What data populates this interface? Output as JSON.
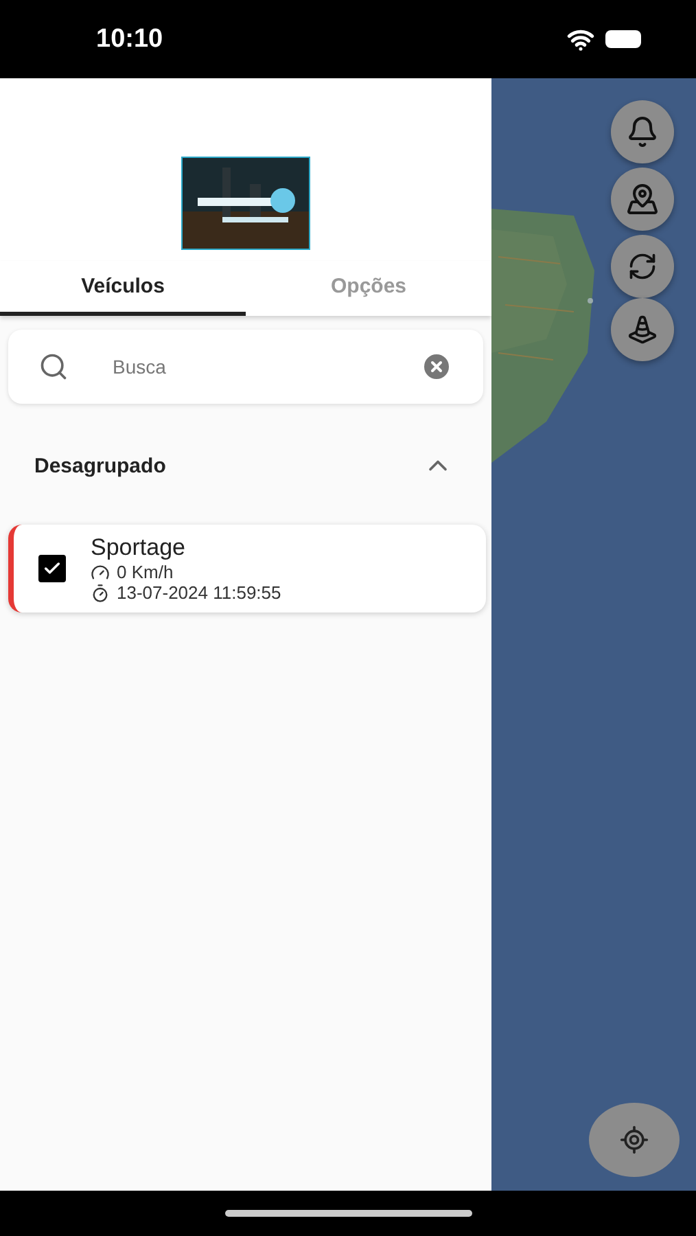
{
  "status_bar": {
    "time": "10:10"
  },
  "tabs": [
    {
      "label": "Veículos",
      "selected": true
    },
    {
      "label": "Opções",
      "selected": false
    }
  ],
  "search": {
    "placeholder": "Busca"
  },
  "group": {
    "title": "Desagrupado",
    "expanded": true
  },
  "vehicles": [
    {
      "name": "Sportage",
      "checked": true,
      "speed": "0 Km/h",
      "timestamp": "13-07-2024 11:59:55",
      "color": "#e53935"
    }
  ]
}
